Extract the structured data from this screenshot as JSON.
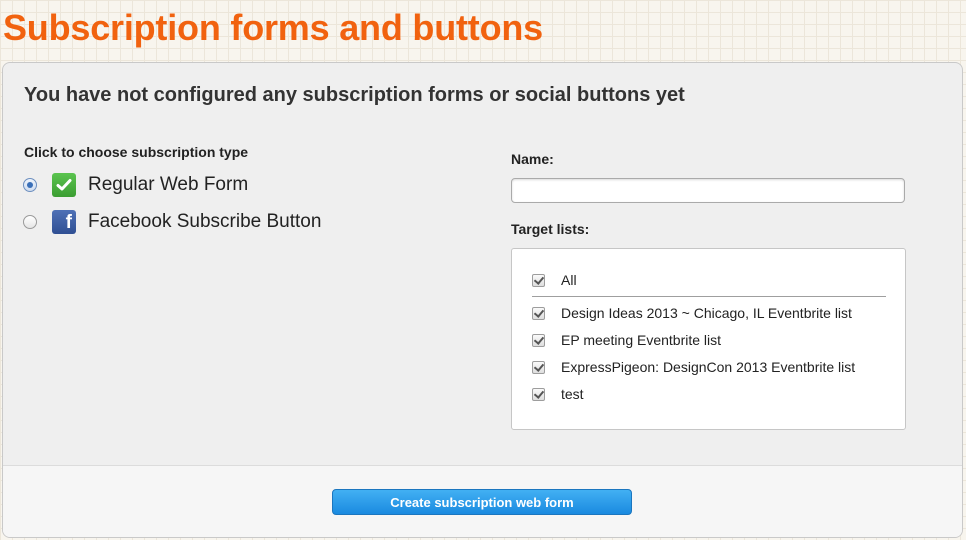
{
  "page": {
    "title": "Subscription forms and buttons"
  },
  "panel": {
    "heading": "You have not configured any subscription forms or social buttons yet",
    "type_section": {
      "label": "Click to choose subscription type",
      "options": [
        {
          "label": "Regular Web Form",
          "selected": true,
          "icon": "green-check-icon"
        },
        {
          "label": "Facebook Subscribe Button",
          "selected": false,
          "icon": "facebook-icon"
        }
      ]
    },
    "name_field": {
      "label": "Name:",
      "value": "",
      "placeholder": ""
    },
    "target_lists": {
      "label": "Target lists:",
      "all_label": "All",
      "items": [
        {
          "label": "Design Ideas 2013 ~ Chicago, IL Eventbrite list",
          "checked": true
        },
        {
          "label": "EP meeting Eventbrite list",
          "checked": true
        },
        {
          "label": "ExpressPigeon: DesignCon 2013 Eventbrite list",
          "checked": true
        },
        {
          "label": "test",
          "checked": true
        }
      ]
    },
    "create_button": "Create subscription web form"
  },
  "colors": {
    "title": "#f1620f",
    "button": "#2a9cea",
    "icon_green": "#4cb443",
    "facebook": "#3b5998"
  }
}
